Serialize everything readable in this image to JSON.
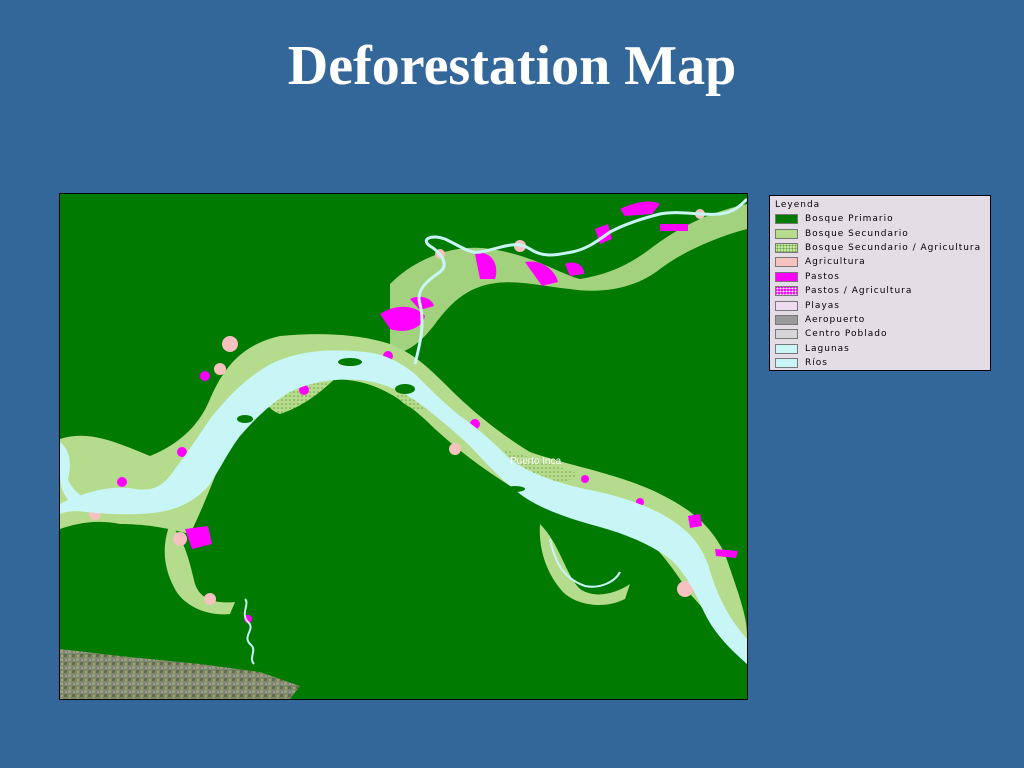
{
  "slide": {
    "title": "Deforestation Map"
  },
  "map": {
    "place_label": "Puerto Inca",
    "colors": {
      "forest": "#007a00",
      "secondary_forest": "#b5dc8c",
      "agriculture": "#f5c2bf",
      "pasture": "#ff00ff",
      "river": "#c8f6f6",
      "lagoon": "#ccf5f5"
    }
  },
  "legend": {
    "title": "Leyenda",
    "items": [
      {
        "label": "Bosque Primario",
        "color": "#007a00",
        "pattern": "solid"
      },
      {
        "label": "Bosque Secundario",
        "color": "#b5dc8c",
        "pattern": "solid"
      },
      {
        "label": "Bosque Secundario / Agricultura",
        "color": "#c8e6a0",
        "pattern": "dots"
      },
      {
        "label": "Agricultura",
        "color": "#f5c2bf",
        "pattern": "solid"
      },
      {
        "label": "Pastos",
        "color": "#ff00ff",
        "pattern": "solid"
      },
      {
        "label": "Pastos / Agricultura",
        "color": "#ff00ff",
        "pattern": "hatch"
      },
      {
        "label": "Playas",
        "color": "#f0dcf0",
        "pattern": "solid"
      },
      {
        "label": "Aeropuerto",
        "color": "#9a9a9a",
        "pattern": "solid"
      },
      {
        "label": "Centro Poblado",
        "color": "#d6d6d6",
        "pattern": "solid"
      },
      {
        "label": "Lagunas",
        "color": "#ccf5f5",
        "pattern": "solid"
      },
      {
        "label": "Ríos",
        "color": "#c8f6f6",
        "pattern": "solid"
      }
    ]
  }
}
